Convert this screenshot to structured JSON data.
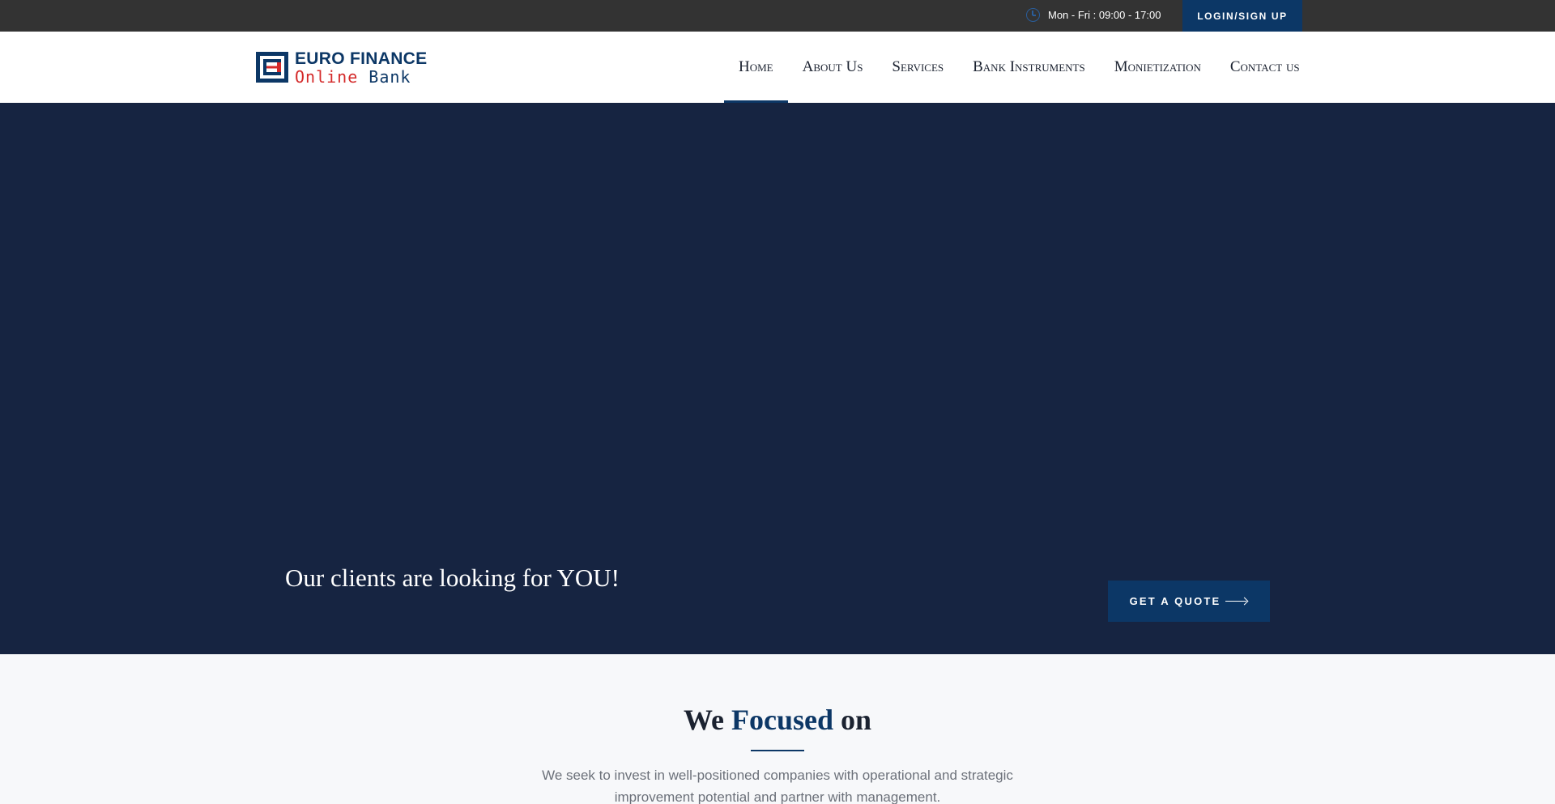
{
  "topbar": {
    "hours": "Mon - Fri : 09:00 - 17:00",
    "login_label": "LOGIN/SIGN UP"
  },
  "logo": {
    "line1": "EURO FINANCE",
    "line2_online": "Online",
    "line2_bank": "Bank"
  },
  "nav": {
    "items": [
      {
        "label": "Home",
        "active": true
      },
      {
        "label": "About Us"
      },
      {
        "label": "Services"
      },
      {
        "label": "Bank Instruments"
      },
      {
        "label": "Monietization"
      },
      {
        "label": "Contact us"
      }
    ]
  },
  "hero": {
    "tagline": "Our clients are looking for YOU!",
    "cta_label": "GET A QUOTE"
  },
  "focus": {
    "title_before": "We",
    "title_accent": "Focused",
    "title_after": "on",
    "description": "We seek to invest in well-positioned companies with operational and strategic improvement potential and partner with management."
  },
  "colors": {
    "topbar_bg": "#333333",
    "brand_navy": "#0c3766",
    "hero_bg": "#162441",
    "logo_red": "#d42a2a",
    "section_bg": "#f7f8fa"
  },
  "icons": {
    "hours": "clock-icon",
    "cta": "arrow-right-icon"
  }
}
